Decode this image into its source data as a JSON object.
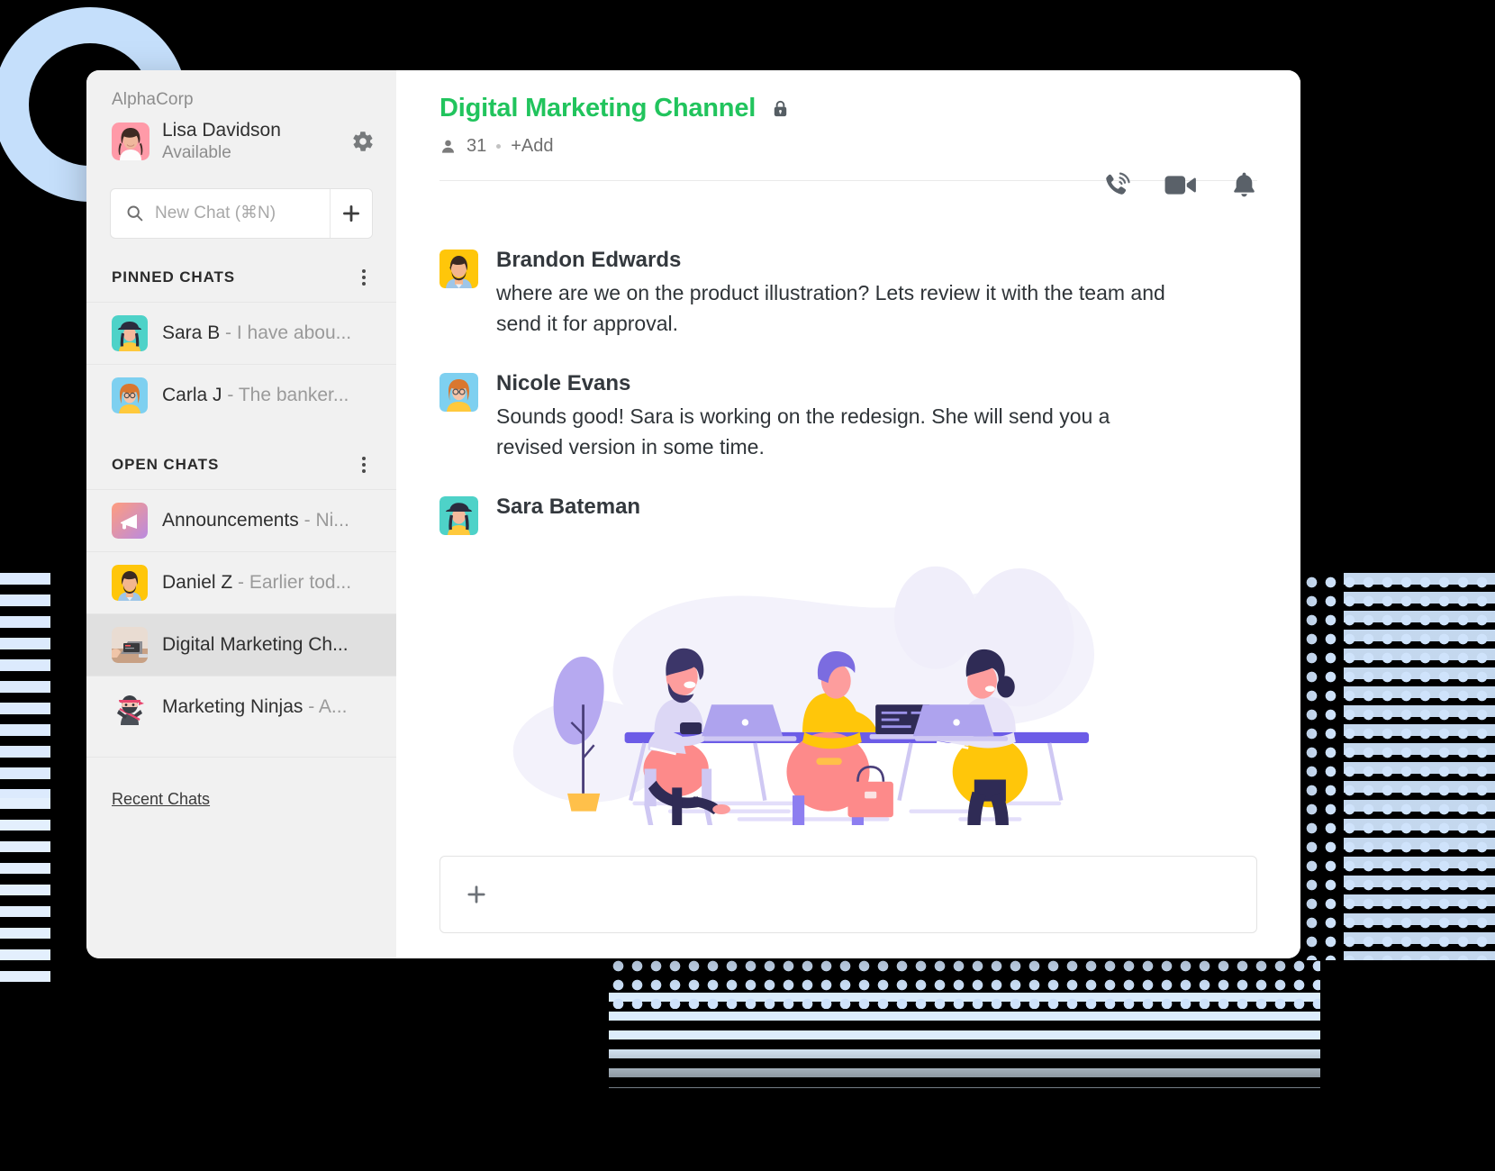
{
  "sidebar": {
    "org_name": "AlphaCorp",
    "user": {
      "name": "Lisa Davidson",
      "status": "Available"
    },
    "settings_icon": "gear-icon",
    "search": {
      "placeholder": "New Chat (⌘N)",
      "value": "",
      "icon": "search-icon",
      "add_label": "+"
    },
    "sections": [
      {
        "title": "PINNED CHATS",
        "items": [
          {
            "name": "Sara B",
            "preview": " - I have abou...",
            "avatar": "sara-b-avatar"
          },
          {
            "name": "Carla J",
            "preview": " - The banker...",
            "avatar": "carla-j-avatar"
          }
        ]
      },
      {
        "title": "OPEN CHATS",
        "items": [
          {
            "name": "Announcements",
            "preview": " - Ni...",
            "avatar": "announcements-avatar"
          },
          {
            "name": "Daniel Z",
            "preview": " - Earlier tod...",
            "avatar": "daniel-z-avatar"
          },
          {
            "name": "Digital Marketing Ch...",
            "preview": "",
            "avatar": "digital-marketing-avatar",
            "active": true
          },
          {
            "name": "Marketing Ninjas",
            "preview": " - A...",
            "avatar": "marketing-ninjas-avatar"
          }
        ]
      }
    ],
    "recent_chats_label": "Recent Chats"
  },
  "header": {
    "channel_title": "Digital Marketing Channel",
    "lock_icon": "lock-icon",
    "member_count": "31",
    "add_label": "+Add",
    "actions": [
      {
        "icon": "phone-call-icon",
        "name": "audio-call-button"
      },
      {
        "icon": "video-camera-icon",
        "name": "video-call-button"
      },
      {
        "icon": "bell-icon",
        "name": "notifications-button"
      }
    ]
  },
  "messages": [
    {
      "author": "Brandon Edwards",
      "avatar": "brandon-edwards-avatar",
      "text": "where are we on the product illustration? Lets review it with the team and send it for approval."
    },
    {
      "author": "Nicole Evans",
      "avatar": "nicole-evans-avatar",
      "text": "Sounds good! Sara is working on the redesign. She will send you a revised version in some time."
    },
    {
      "author": "Sara Bateman",
      "avatar": "sara-bateman-avatar",
      "text": "",
      "attachment": "team-working-illustration"
    }
  ],
  "composer": {
    "add_label": "+",
    "placeholder": ""
  },
  "colors": {
    "accent_green": "#21c45d",
    "sidebar_bg": "#f1f1f1",
    "active_row": "#e0e0e0",
    "decor_blue": "#c5dffb",
    "illustration_purple": "#6c5ce7",
    "illustration_pink": "#fd8a8a"
  }
}
